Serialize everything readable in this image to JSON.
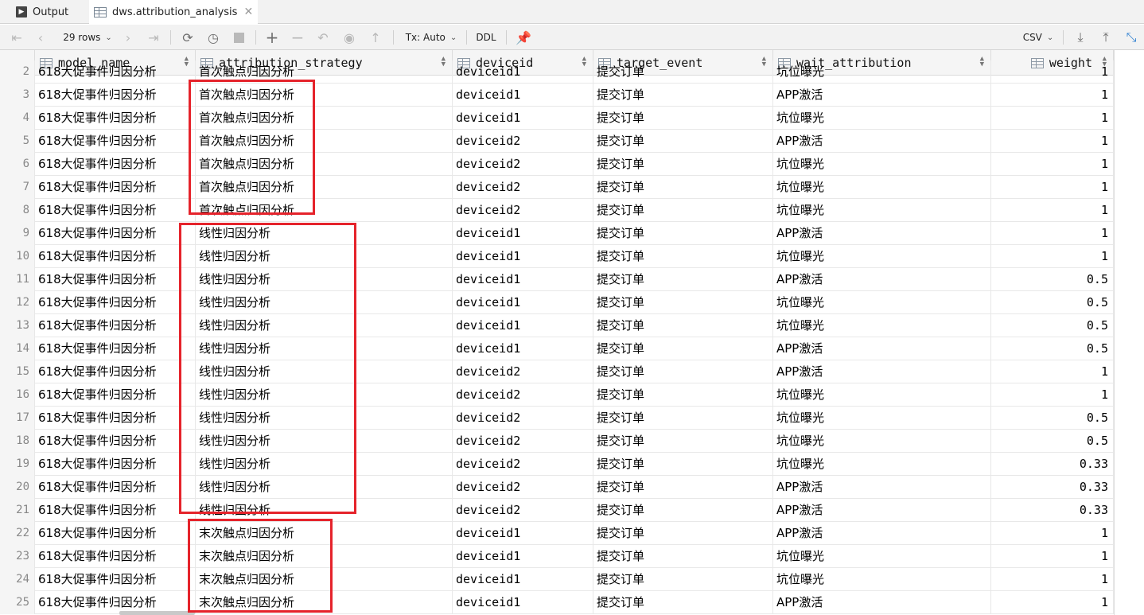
{
  "tabs": [
    {
      "label": "Output",
      "icon": "console-icon"
    },
    {
      "label": "dws.attribution_analysis",
      "icon": "table-icon"
    }
  ],
  "toolbar": {
    "rows_label": "29 rows",
    "tx_label": "Tx: Auto",
    "ddl_label": "DDL",
    "export_label": "CSV"
  },
  "columns": [
    {
      "key": "model_name",
      "label": "model_name"
    },
    {
      "key": "attribution_strategy",
      "label": "attribution_strategy"
    },
    {
      "key": "deviceid",
      "label": "deviceid"
    },
    {
      "key": "target_event",
      "label": "target_event"
    },
    {
      "key": "wait_attribution",
      "label": "wait_attribution"
    },
    {
      "key": "weight",
      "label": "weight"
    }
  ],
  "rows": [
    {
      "n": "2",
      "model_name": "618大促事件归因分析",
      "attribution_strategy": "首次触点归因分析",
      "deviceid": "deviceid1",
      "target_event": "提交订单",
      "wait_attribution": "坑位曝光",
      "weight": "1"
    },
    {
      "n": "3",
      "model_name": "618大促事件归因分析",
      "attribution_strategy": "首次触点归因分析",
      "deviceid": "deviceid1",
      "target_event": "提交订单",
      "wait_attribution": "APP激活",
      "weight": "1"
    },
    {
      "n": "4",
      "model_name": "618大促事件归因分析",
      "attribution_strategy": "首次触点归因分析",
      "deviceid": "deviceid1",
      "target_event": "提交订单",
      "wait_attribution": "坑位曝光",
      "weight": "1"
    },
    {
      "n": "5",
      "model_name": "618大促事件归因分析",
      "attribution_strategy": "首次触点归因分析",
      "deviceid": "deviceid2",
      "target_event": "提交订单",
      "wait_attribution": "APP激活",
      "weight": "1"
    },
    {
      "n": "6",
      "model_name": "618大促事件归因分析",
      "attribution_strategy": "首次触点归因分析",
      "deviceid": "deviceid2",
      "target_event": "提交订单",
      "wait_attribution": "坑位曝光",
      "weight": "1"
    },
    {
      "n": "7",
      "model_name": "618大促事件归因分析",
      "attribution_strategy": "首次触点归因分析",
      "deviceid": "deviceid2",
      "target_event": "提交订单",
      "wait_attribution": "坑位曝光",
      "weight": "1"
    },
    {
      "n": "8",
      "model_name": "618大促事件归因分析",
      "attribution_strategy": "首次触点归因分析",
      "deviceid": "deviceid2",
      "target_event": "提交订单",
      "wait_attribution": "坑位曝光",
      "weight": "1"
    },
    {
      "n": "9",
      "model_name": "618大促事件归因分析",
      "attribution_strategy": "线性归因分析",
      "deviceid": "deviceid1",
      "target_event": "提交订单",
      "wait_attribution": "APP激活",
      "weight": "1"
    },
    {
      "n": "10",
      "model_name": "618大促事件归因分析",
      "attribution_strategy": "线性归因分析",
      "deviceid": "deviceid1",
      "target_event": "提交订单",
      "wait_attribution": "坑位曝光",
      "weight": "1"
    },
    {
      "n": "11",
      "model_name": "618大促事件归因分析",
      "attribution_strategy": "线性归因分析",
      "deviceid": "deviceid1",
      "target_event": "提交订单",
      "wait_attribution": "APP激活",
      "weight": "0.5"
    },
    {
      "n": "12",
      "model_name": "618大促事件归因分析",
      "attribution_strategy": "线性归因分析",
      "deviceid": "deviceid1",
      "target_event": "提交订单",
      "wait_attribution": "坑位曝光",
      "weight": "0.5"
    },
    {
      "n": "13",
      "model_name": "618大促事件归因分析",
      "attribution_strategy": "线性归因分析",
      "deviceid": "deviceid1",
      "target_event": "提交订单",
      "wait_attribution": "坑位曝光",
      "weight": "0.5"
    },
    {
      "n": "14",
      "model_name": "618大促事件归因分析",
      "attribution_strategy": "线性归因分析",
      "deviceid": "deviceid1",
      "target_event": "提交订单",
      "wait_attribution": "APP激活",
      "weight": "0.5"
    },
    {
      "n": "15",
      "model_name": "618大促事件归因分析",
      "attribution_strategy": "线性归因分析",
      "deviceid": "deviceid2",
      "target_event": "提交订单",
      "wait_attribution": "APP激活",
      "weight": "1"
    },
    {
      "n": "16",
      "model_name": "618大促事件归因分析",
      "attribution_strategy": "线性归因分析",
      "deviceid": "deviceid2",
      "target_event": "提交订单",
      "wait_attribution": "坑位曝光",
      "weight": "1"
    },
    {
      "n": "17",
      "model_name": "618大促事件归因分析",
      "attribution_strategy": "线性归因分析",
      "deviceid": "deviceid2",
      "target_event": "提交订单",
      "wait_attribution": "坑位曝光",
      "weight": "0.5"
    },
    {
      "n": "18",
      "model_name": "618大促事件归因分析",
      "attribution_strategy": "线性归因分析",
      "deviceid": "deviceid2",
      "target_event": "提交订单",
      "wait_attribution": "坑位曝光",
      "weight": "0.5"
    },
    {
      "n": "19",
      "model_name": "618大促事件归因分析",
      "attribution_strategy": "线性归因分析",
      "deviceid": "deviceid2",
      "target_event": "提交订单",
      "wait_attribution": "坑位曝光",
      "weight": "0.33"
    },
    {
      "n": "20",
      "model_name": "618大促事件归因分析",
      "attribution_strategy": "线性归因分析",
      "deviceid": "deviceid2",
      "target_event": "提交订单",
      "wait_attribution": "APP激活",
      "weight": "0.33"
    },
    {
      "n": "21",
      "model_name": "618大促事件归因分析",
      "attribution_strategy": "线性归因分析",
      "deviceid": "deviceid2",
      "target_event": "提交订单",
      "wait_attribution": "APP激活",
      "weight": "0.33"
    },
    {
      "n": "22",
      "model_name": "618大促事件归因分析",
      "attribution_strategy": "末次触点归因分析",
      "deviceid": "deviceid1",
      "target_event": "提交订单",
      "wait_attribution": "APP激活",
      "weight": "1"
    },
    {
      "n": "23",
      "model_name": "618大促事件归因分析",
      "attribution_strategy": "末次触点归因分析",
      "deviceid": "deviceid1",
      "target_event": "提交订单",
      "wait_attribution": "坑位曝光",
      "weight": "1"
    },
    {
      "n": "24",
      "model_name": "618大促事件归因分析",
      "attribution_strategy": "末次触点归因分析",
      "deviceid": "deviceid1",
      "target_event": "提交订单",
      "wait_attribution": "坑位曝光",
      "weight": "1"
    },
    {
      "n": "25",
      "model_name": "618大促事件归因分析",
      "attribution_strategy": "末次触点归因分析",
      "deviceid": "deviceid1",
      "target_event": "提交订单",
      "wait_attribution": "APP激活",
      "weight": "1"
    }
  ],
  "colors": {
    "annotation": "#e5232b",
    "header_bg": "#f5f5f5",
    "toolbar_bg": "#f2f2f2"
  }
}
